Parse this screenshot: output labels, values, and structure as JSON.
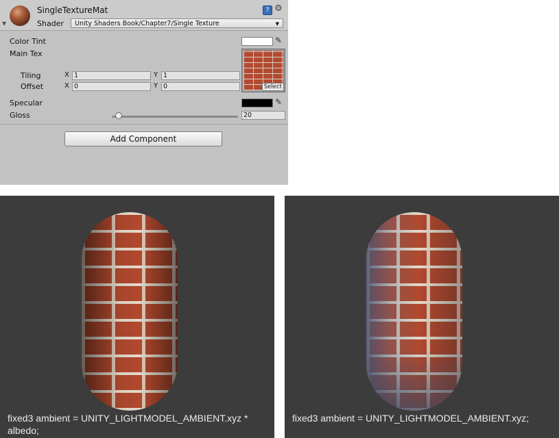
{
  "inspector": {
    "material_name": "SingleTextureMat",
    "shader_label": "Shader",
    "shader_value": "Unity Shaders Book/Chapter7/Single Texture",
    "properties": {
      "color_tint": "Color Tint",
      "main_tex": "Main Tex",
      "tiling": "Tiling",
      "offset": "Offset",
      "axis_x": "X",
      "axis_y": "Y",
      "tiling_x": "1",
      "tiling_y": "1",
      "offset_x": "0",
      "offset_y": "0",
      "select_button": "Select",
      "specular": "Specular",
      "gloss": "Gloss",
      "gloss_value": "20"
    },
    "color_tint_value": "#ffffff",
    "specular_value": "#000000",
    "add_component": "Add Component"
  },
  "renders": {
    "left_caption": "fixed3 ambient = UNITY_LIGHTMODEL_AMBIENT.xyz * albedo;",
    "right_caption": "fixed3 ambient = UNITY_LIGHTMODEL_AMBIENT.xyz;"
  }
}
